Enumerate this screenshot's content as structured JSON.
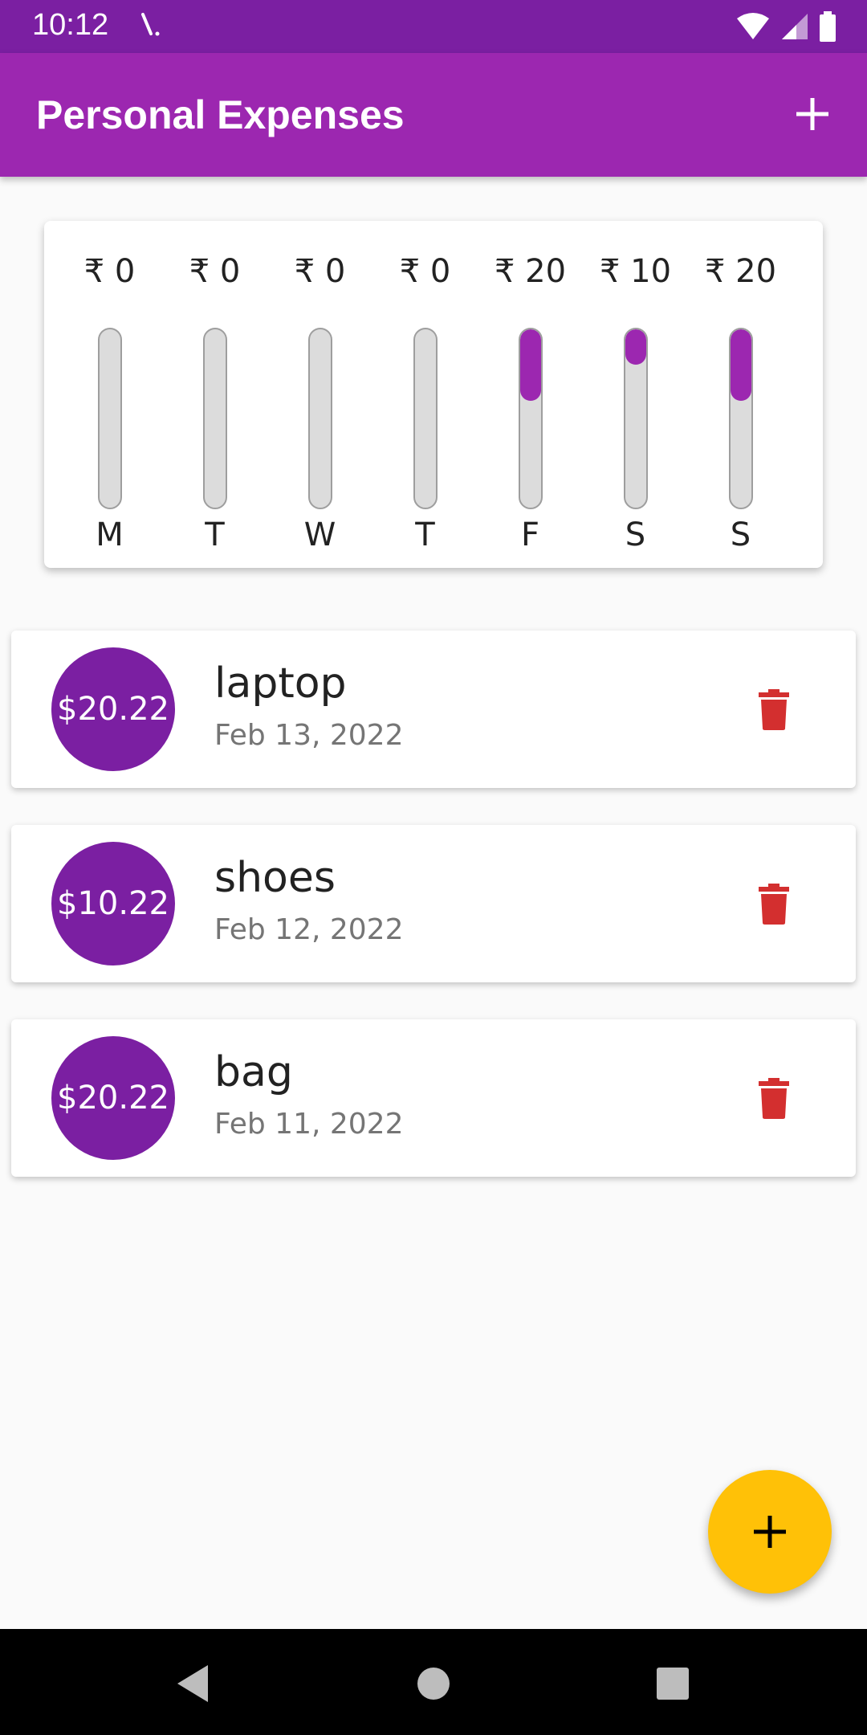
{
  "status_bar": {
    "time": "10:12"
  },
  "app_bar": {
    "title": "Personal Expenses",
    "add_icon": "plus-icon"
  },
  "chart_data": {
    "type": "bar",
    "categories": [
      "M",
      "T",
      "W",
      "T",
      "F",
      "S",
      "S"
    ],
    "value_labels": [
      "₹ 0",
      "₹ 0",
      "₹ 0",
      "₹ 0",
      "₹ 20",
      "₹ 10",
      "₹ 20"
    ],
    "fill_fraction": [
      0,
      0,
      0,
      0,
      0.4,
      0.2,
      0.4
    ],
    "values": [
      0,
      0,
      0,
      0,
      20,
      10,
      20
    ]
  },
  "transactions": [
    {
      "amount": "$20.22",
      "title": "laptop",
      "date": "Feb 13, 2022"
    },
    {
      "amount": "$10.22",
      "title": "shoes",
      "date": "Feb 12, 2022"
    },
    {
      "amount": "$20.22",
      "title": "bag",
      "date": "Feb 11, 2022"
    }
  ],
  "colors": {
    "primary": "#9c27b0",
    "primary_dark": "#7b1fa2",
    "accent": "#ffc107",
    "delete": "#d32f2f"
  },
  "fab": {
    "icon": "plus-icon"
  }
}
